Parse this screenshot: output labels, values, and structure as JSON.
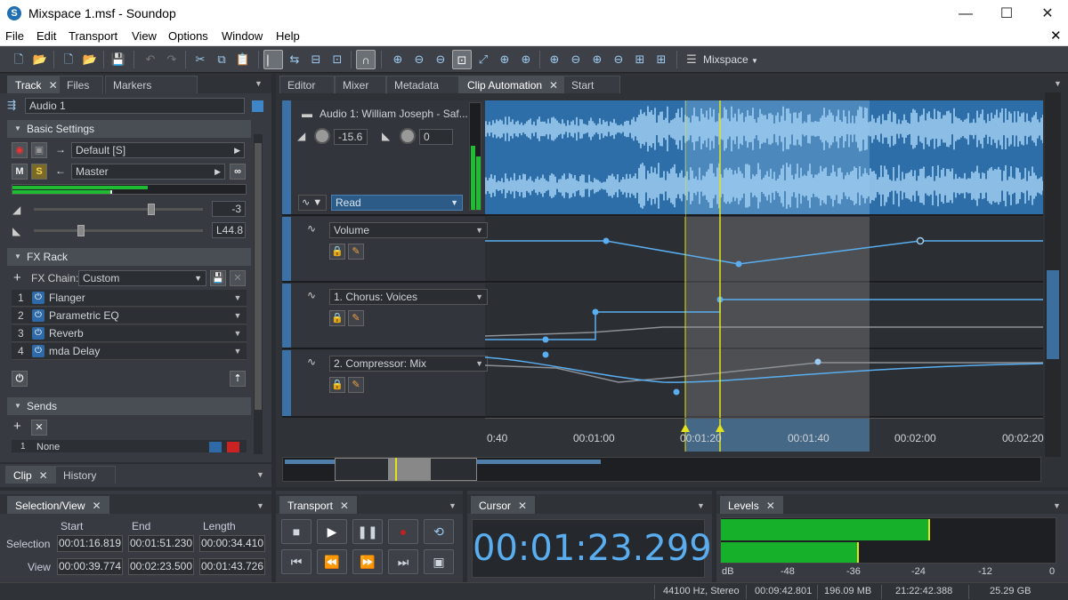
{
  "window": {
    "title": "Mixspace 1.msf - Soundop",
    "min": "—",
    "max": "☐",
    "close": "✕"
  },
  "menu": [
    "File",
    "Edit",
    "Transport",
    "View",
    "Options",
    "Window",
    "Help"
  ],
  "toolbar": {
    "layout_label": "Mixspace"
  },
  "left_tabs": [
    {
      "label": "Track"
    },
    {
      "label": "Files"
    },
    {
      "label": "Markers"
    }
  ],
  "track": {
    "name": "Audio 1",
    "basic_settings": "Basic Settings",
    "input": "Default [S]",
    "output": "Master",
    "m": "M",
    "s": "S",
    "volume": "-3",
    "pan": "L44.8"
  },
  "fxrack": {
    "title": "FX Rack",
    "chain_label": "FX Chain:",
    "chain_value": "Custom",
    "items": [
      {
        "n": "1",
        "name": "Flanger"
      },
      {
        "n": "2",
        "name": "Parametric EQ"
      },
      {
        "n": "3",
        "name": "Reverb"
      },
      {
        "n": "4",
        "name": "mda Delay"
      }
    ]
  },
  "sends": {
    "title": "Sends",
    "first": "None",
    "first_n": "1"
  },
  "bottom_left_tabs": [
    {
      "label": "Clip"
    },
    {
      "label": "History"
    }
  ],
  "main_tabs": [
    {
      "label": "Editor"
    },
    {
      "label": "Mixer"
    },
    {
      "label": "Metadata"
    },
    {
      "label": "Clip Automation"
    },
    {
      "label": "Start"
    }
  ],
  "clip": {
    "title": "Audio 1: William Joseph - Saf...",
    "volume": "-15.6",
    "pan": "0",
    "mode": "Read"
  },
  "lanes": [
    {
      "label": "Volume"
    },
    {
      "label": "1. Chorus: Voices"
    },
    {
      "label": "2. Compressor: Mix"
    }
  ],
  "ruler": [
    "0:40",
    "00:01:00",
    "00:01:20",
    "00:01:40",
    "00:02:00",
    "00:02:20"
  ],
  "selection": {
    "tab": "Selection/View",
    "start_h": "Start",
    "end_h": "End",
    "length_h": "Length",
    "sel_label": "Selection",
    "view_label": "View",
    "sel_start": "00:01:16.819",
    "sel_end": "00:01:51.230",
    "sel_len": "00:00:34.410",
    "view_start": "00:00:39.774",
    "view_end": "00:02:23.500",
    "view_len": "00:01:43.726"
  },
  "transport": {
    "tab": "Transport"
  },
  "cursor": {
    "tab": "Cursor",
    "time": "00:01:23.299"
  },
  "levels": {
    "tab": "Levels",
    "scale": [
      "dB",
      "-48",
      "-36",
      "-24",
      "-12",
      "0"
    ],
    "left_level": 0.62,
    "right_level": 0.41
  },
  "status": {
    "format": "44100 Hz, Stereo",
    "duration": "00:09:42.801",
    "size": "196.09 MB",
    "free_time": "21:22:42.388",
    "disk": "25.29 GB"
  },
  "colors": {
    "accent": "#5aaef0",
    "meter": "#17b02a",
    "playhead": "#e4e21a"
  }
}
